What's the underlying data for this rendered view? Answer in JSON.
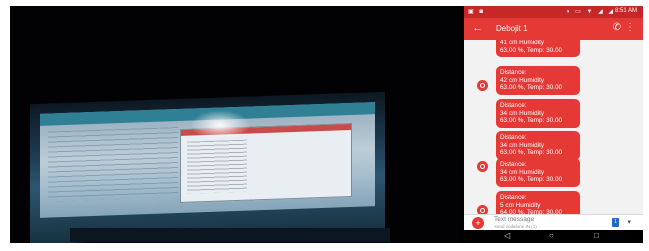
{
  "phone": {
    "statusbar": {
      "left_icons": "▣ ◙",
      "sys_icons": "◑ ▭ ▼ ◢ ◢",
      "time": "8:51 AM"
    },
    "appbar": {
      "back_icon": "←",
      "title": "Debojit 1",
      "call_icon": "✆",
      "more_icon": "⋮"
    },
    "messages": [
      {
        "text": "41  cm Humidity\n63.00 %, Temp: 30.00"
      },
      {
        "text": "Distance:\n42  cm Humidity\n63.00 %, Temp: 30.00"
      },
      {
        "text": "Distance:\n34  cm Humidity\n63.00 %, Temp: 30.00"
      },
      {
        "text": "Distance:\n34  cm Humidity\n63.00 %, Temp: 30.00"
      },
      {
        "text": "Distance:\n34  cm Humidity\n63.00 %, Temp: 30.00"
      },
      {
        "text": "Distance:\n5  cm Humidity\n64.00 %, Temp: 30.00"
      }
    ],
    "composer": {
      "add_icon": "+",
      "placeholder": "Text message",
      "sim_label": "Send vodafone IN (1)",
      "sim_icon": "1",
      "caret_icon": "▾"
    },
    "navbar": {
      "back": "◁",
      "home": "○",
      "recents": "□"
    }
  },
  "colors": {
    "accent": "#e53935",
    "statusbar": "#c62828",
    "background": "#000000"
  }
}
